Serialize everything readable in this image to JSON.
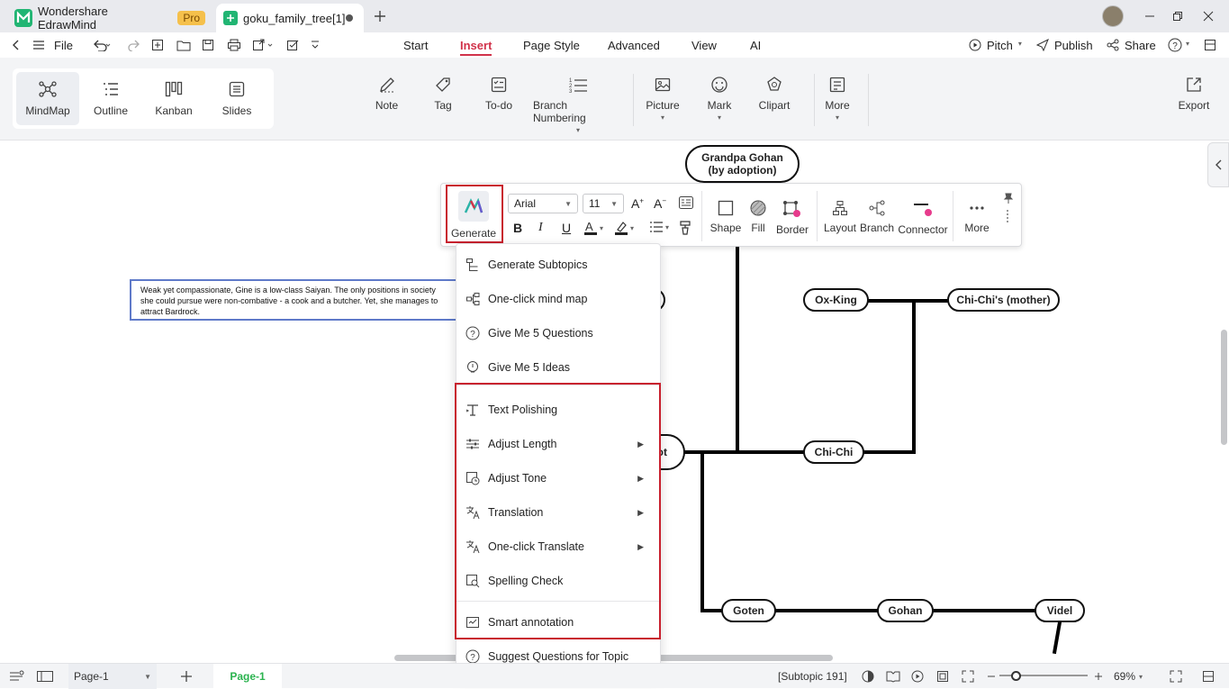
{
  "app": {
    "name": "Wondershare EdrawMind",
    "badge": "Pro"
  },
  "document_tab": {
    "title": "goku_family_tree[1]"
  },
  "menu": {
    "file": "File",
    "tabs": [
      "Start",
      "Insert",
      "Page Style",
      "Advanced",
      "View",
      "AI"
    ],
    "active_tab": "Insert",
    "right": {
      "pitch": "Pitch",
      "publish": "Publish",
      "share": "Share"
    }
  },
  "ribbon": {
    "views": [
      "MindMap",
      "Outline",
      "Kanban",
      "Slides"
    ],
    "insert": [
      "Note",
      "Tag",
      "To-do",
      "Branch Numbering",
      "Picture",
      "Mark",
      "Clipart",
      "More"
    ],
    "export": "Export"
  },
  "float_toolbar": {
    "generate": "Generate",
    "font": "Arial",
    "size": "11",
    "bold": "B",
    "italic": "I",
    "underline": "U",
    "tools": [
      "Shape",
      "Fill",
      "Border",
      "Layout",
      "Branch",
      "Connector",
      "More"
    ]
  },
  "ai_menu": {
    "items": [
      {
        "label": "Generate Subtopics",
        "submenu": false
      },
      {
        "label": "One-click mind map",
        "submenu": false
      },
      {
        "label": "Give Me 5 Questions",
        "submenu": false
      },
      {
        "label": "Give Me 5 Ideas",
        "submenu": false
      },
      {
        "label": "Text Polishing",
        "submenu": false
      },
      {
        "label": "Adjust Length",
        "submenu": true
      },
      {
        "label": "Adjust Tone",
        "submenu": true
      },
      {
        "label": "Translation",
        "submenu": true
      },
      {
        "label": "One-click Translate",
        "submenu": true
      },
      {
        "label": "Spelling Check",
        "submenu": false
      },
      {
        "label": "Smart annotation",
        "submenu": false
      },
      {
        "label": "Suggest Questions for Topic",
        "submenu": false
      }
    ]
  },
  "mindmap": {
    "nodes": {
      "grandpa": "Grandpa Gohan\n(by adoption)",
      "ox_king": "Ox-King",
      "chichi_mother": "Chi-Chi's (mother)",
      "chichi": "Chi-Chi",
      "goten": "Goten",
      "gohan": "Gohan",
      "videl": "Videl",
      "partial": "ot"
    },
    "note_text": "Weak yet compassionate, Gine is a low-class Saiyan. The only positions in society she could pursue were non-combative - a cook and a butcher. Yet, she manages to attract Bardrock."
  },
  "status": {
    "page_select": "Page-1",
    "page_tab": "Page-1",
    "selection": "[Subtopic 191]",
    "zoom": "69%"
  },
  "colors": {
    "accent": "#d1324a",
    "highlight_box": "#c8202e",
    "note_border": "#5f7ac9"
  }
}
